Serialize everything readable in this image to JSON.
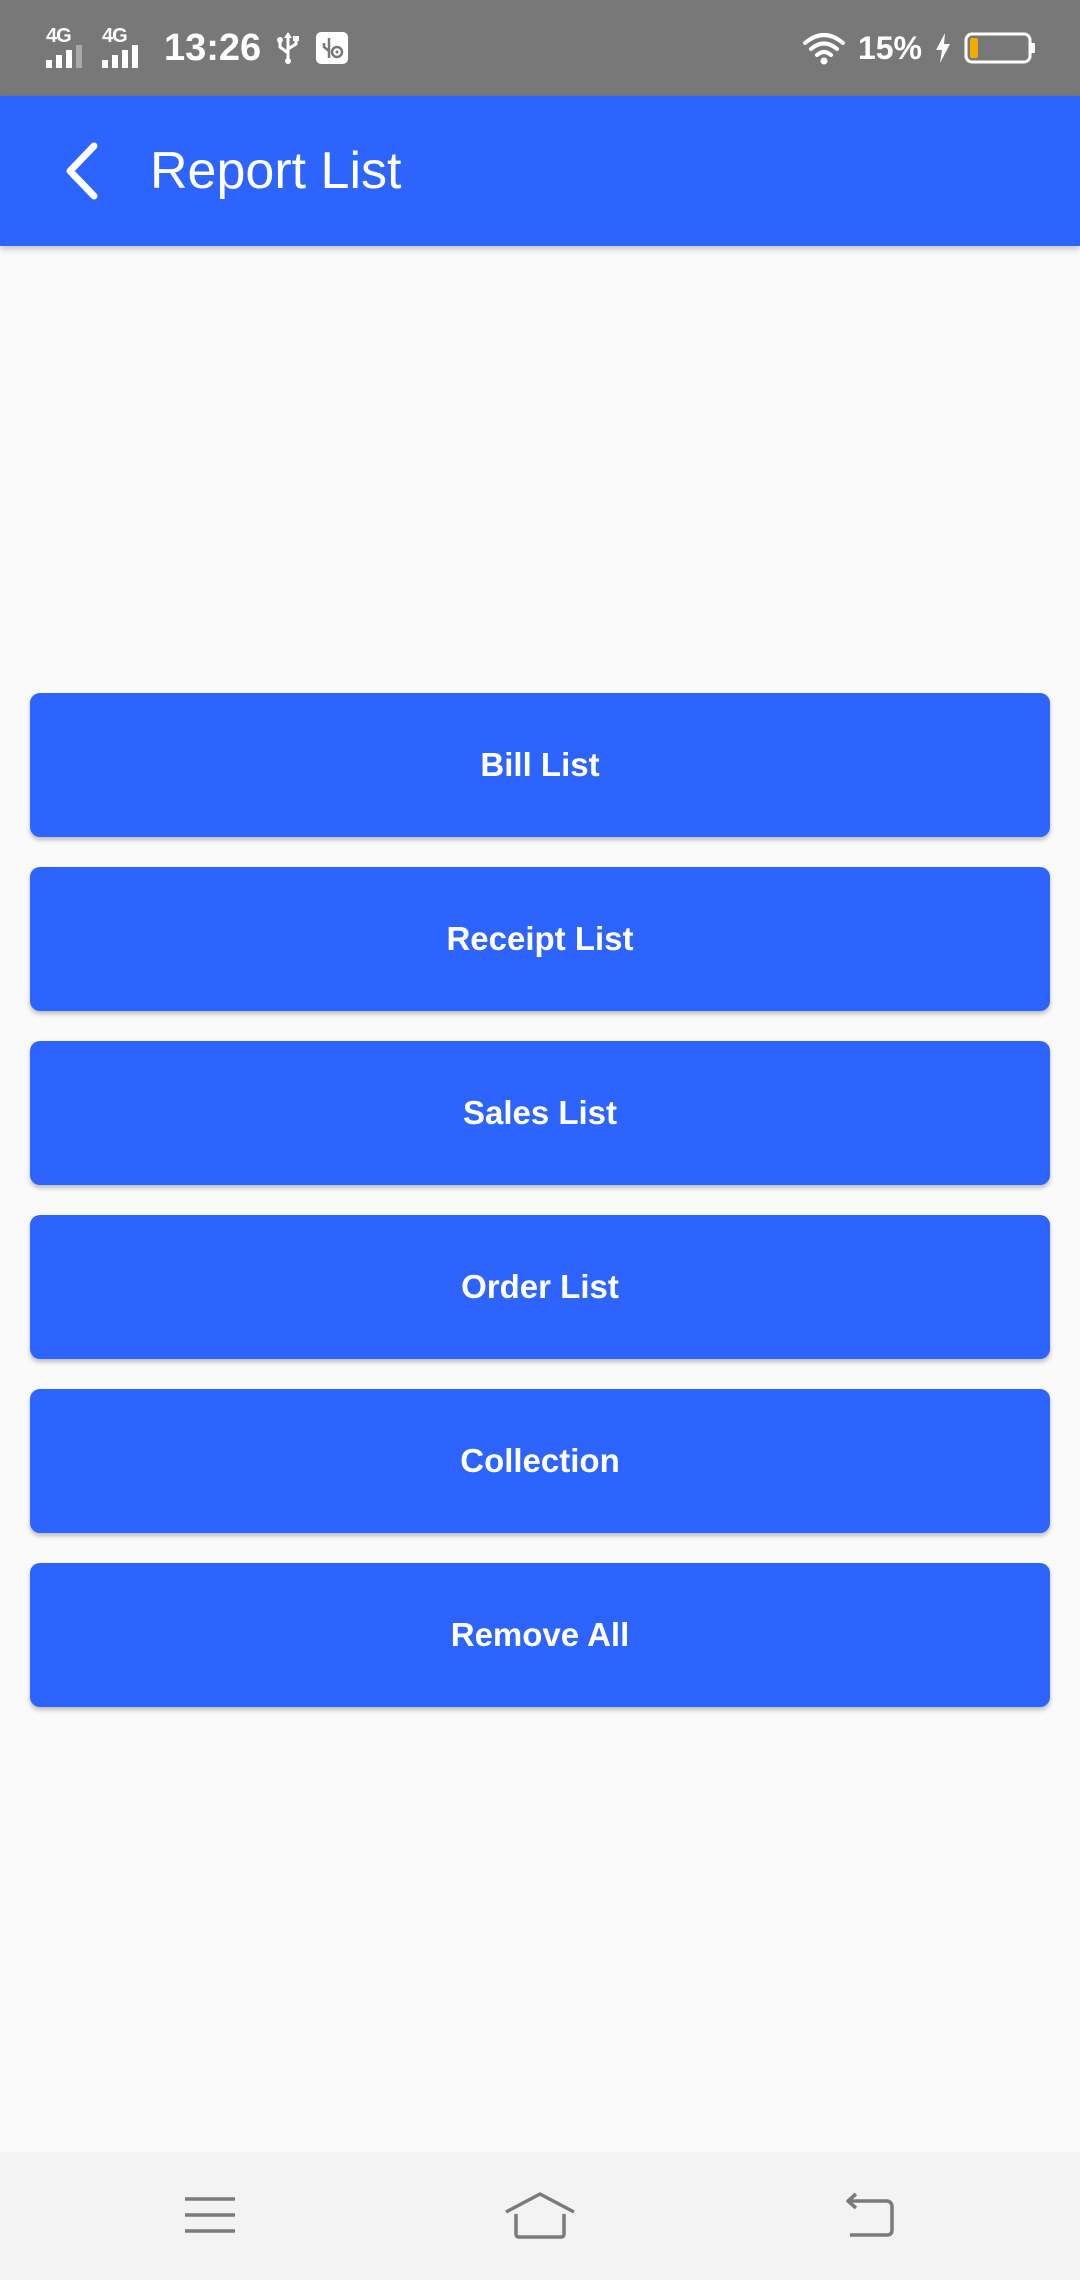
{
  "status_bar": {
    "network_1": "4G",
    "network_2": "4G",
    "time": "13:26",
    "battery_percent": "15%",
    "battery_level": 0.15,
    "icons": [
      "signal-icon",
      "signal-icon",
      "usb-icon",
      "usb-debug-icon",
      "wifi-icon",
      "charging-icon",
      "battery-icon"
    ]
  },
  "app_bar": {
    "title": "Report List",
    "back_icon": "back-arrow-icon"
  },
  "buttons": [
    {
      "label": "Bill List"
    },
    {
      "label": "Receipt List"
    },
    {
      "label": "Sales List"
    },
    {
      "label": "Order List"
    },
    {
      "label": "Collection"
    },
    {
      "label": "Remove All"
    }
  ],
  "nav_bar": {
    "icons": [
      "menu-icon",
      "home-icon",
      "back-icon"
    ]
  },
  "colors": {
    "primary": "#2e64fe",
    "status_bar": "#787878",
    "background": "#fafafa",
    "battery_fill": "#f5a800"
  }
}
